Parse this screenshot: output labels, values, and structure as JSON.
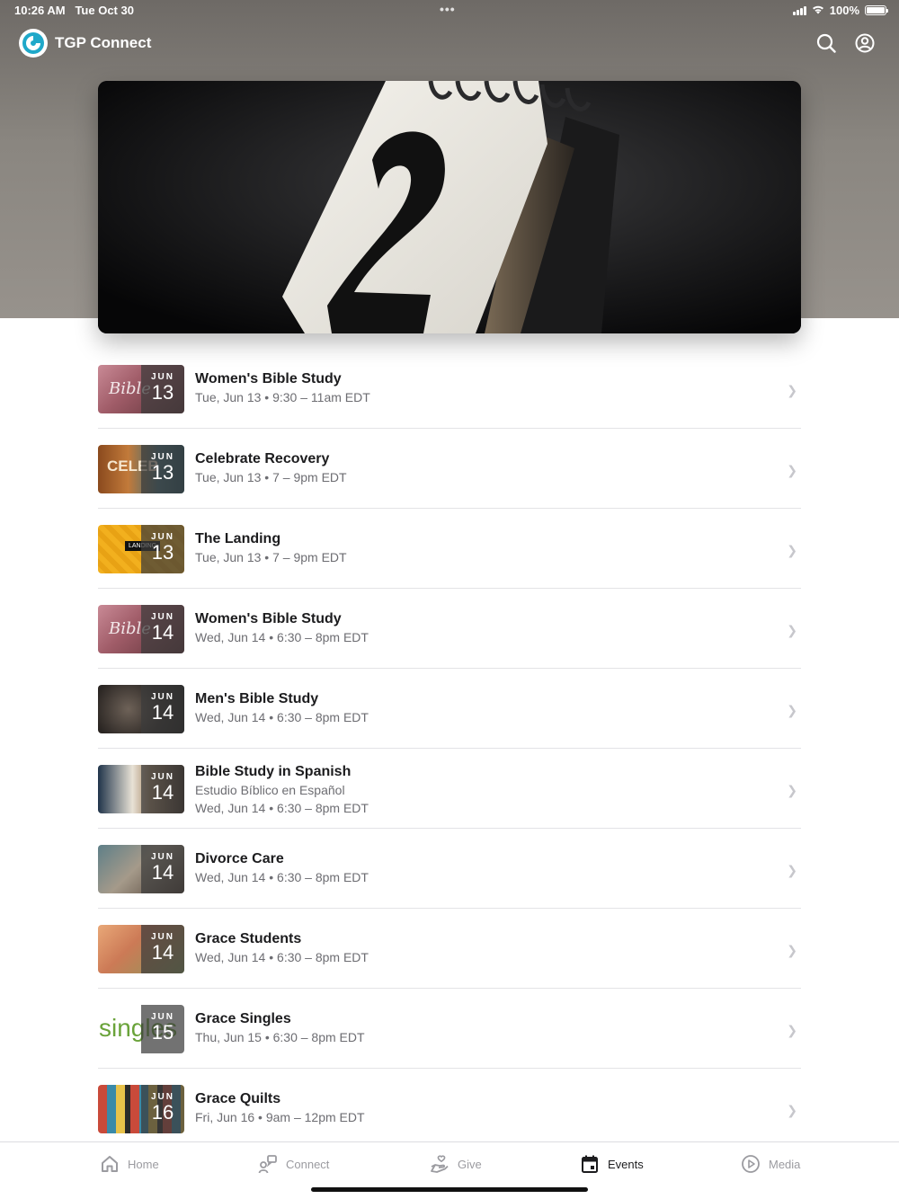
{
  "status_bar": {
    "time": "10:26 AM",
    "date": "Tue Oct 30",
    "dots": "•••",
    "battery": "100%",
    "battery_level": 1.0
  },
  "header": {
    "app_title": "TGP Connect"
  },
  "events": [
    {
      "title": "Women's Bible Study",
      "subtitle": "",
      "time": "Tue, Jun 13 • 9:30 – 11am EDT",
      "month": "JUN",
      "day": "13",
      "thumb_text": "Bible"
    },
    {
      "title": "Celebrate Recovery",
      "subtitle": "",
      "time": "Tue, Jun 13 • 7 – 9pm EDT",
      "month": "JUN",
      "day": "13",
      "thumb_text": "CELEB"
    },
    {
      "title": "The Landing",
      "subtitle": "",
      "time": "Tue, Jun 13 • 7 – 9pm EDT",
      "month": "JUN",
      "day": "13",
      "thumb_text": "LANDING"
    },
    {
      "title": "Women's Bible Study",
      "subtitle": "",
      "time": "Wed, Jun 14 • 6:30 – 8pm EDT",
      "month": "JUN",
      "day": "14",
      "thumb_text": "Bible"
    },
    {
      "title": "Men's Bible Study",
      "subtitle": "",
      "time": "Wed, Jun 14 • 6:30 – 8pm EDT",
      "month": "JUN",
      "day": "14",
      "thumb_text": ""
    },
    {
      "title": "Bible Study in Spanish",
      "subtitle": "Estudio Bíblico en Español",
      "time": "Wed, Jun 14 • 6:30 – 8pm EDT",
      "month": "JUN",
      "day": "14",
      "thumb_text": ""
    },
    {
      "title": "Divorce Care",
      "subtitle": "",
      "time": "Wed, Jun 14 • 6:30 – 8pm EDT",
      "month": "JUN",
      "day": "14",
      "thumb_text": ""
    },
    {
      "title": "Grace Students",
      "subtitle": "",
      "time": "Wed, Jun 14 • 6:30 – 8pm EDT",
      "month": "JUN",
      "day": "14",
      "thumb_text": ""
    },
    {
      "title": "Grace Singles",
      "subtitle": "",
      "time": "Thu, Jun 15 • 6:30 – 8pm EDT",
      "month": "JUN",
      "day": "15",
      "thumb_text": "singles"
    },
    {
      "title": "Grace Quilts",
      "subtitle": "",
      "time": "Fri, Jun 16 • 9am – 12pm EDT",
      "month": "JUN",
      "day": "16",
      "thumb_text": ""
    }
  ],
  "tabs": [
    {
      "label": "Home",
      "icon": "home-icon"
    },
    {
      "label": "Connect",
      "icon": "connect-icon"
    },
    {
      "label": "Give",
      "icon": "give-icon"
    },
    {
      "label": "Events",
      "icon": "calendar-icon",
      "active": true
    },
    {
      "label": "Media",
      "icon": "play-icon"
    }
  ],
  "colors": {
    "accent": "#1c1c1e",
    "inactive": "#9b9ba0",
    "logo": "#1fa8c9"
  }
}
